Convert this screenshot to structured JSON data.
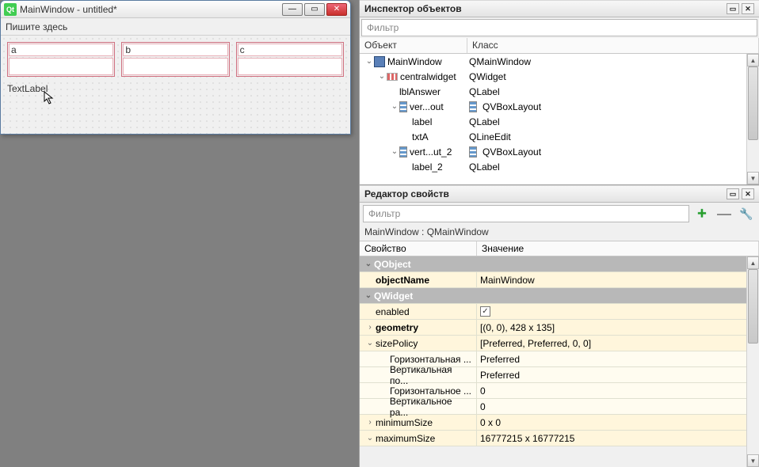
{
  "form": {
    "title": "MainWindow - untitled*",
    "menubar_hint": "Пишите здесь",
    "labels": {
      "a": "a",
      "b": "b",
      "c": "c"
    },
    "textlabel": "TextLabel"
  },
  "inspector": {
    "title": "Инспектор объектов",
    "filter_placeholder": "Фильтр",
    "col_object": "Объект",
    "col_class": "Класс",
    "rows": [
      {
        "indent": 0,
        "arrow": "down",
        "icon": "form",
        "name": "MainWindow",
        "cls_icon": "",
        "cls": "QMainWindow"
      },
      {
        "indent": 1,
        "arrow": "down",
        "icon": "layout",
        "name": "centralwidget",
        "cls_icon": "",
        "cls": "QWidget"
      },
      {
        "indent": 2,
        "arrow": "",
        "icon": "",
        "name": "lblAnswer",
        "cls_icon": "",
        "cls": "QLabel"
      },
      {
        "indent": 2,
        "arrow": "down",
        "icon": "vlayout",
        "name": "ver...out",
        "cls_icon": "vlayout",
        "cls": "QVBoxLayout"
      },
      {
        "indent": 3,
        "arrow": "",
        "icon": "",
        "name": "label",
        "cls_icon": "",
        "cls": "QLabel"
      },
      {
        "indent": 3,
        "arrow": "",
        "icon": "",
        "name": "txtA",
        "cls_icon": "",
        "cls": "QLineEdit"
      },
      {
        "indent": 2,
        "arrow": "down",
        "icon": "vlayout",
        "name": "vert...ut_2",
        "cls_icon": "vlayout",
        "cls": "QVBoxLayout"
      },
      {
        "indent": 3,
        "arrow": "",
        "icon": "",
        "name": "label_2",
        "cls_icon": "",
        "cls": "QLabel"
      }
    ]
  },
  "propeditor": {
    "title": "Редактор свойств",
    "filter_placeholder": "Фильтр",
    "crumb": "MainWindow : QMainWindow",
    "col_prop": "Свойство",
    "col_val": "Значение",
    "rows": [
      {
        "type": "group",
        "arrow": "down",
        "label": "QObject"
      },
      {
        "type": "prop",
        "level": 0,
        "arrow": "",
        "bold": true,
        "key": "objectName",
        "val": "MainWindow"
      },
      {
        "type": "group",
        "arrow": "down",
        "label": "QWidget"
      },
      {
        "type": "prop",
        "level": 0,
        "arrow": "",
        "bold": false,
        "key": "enabled",
        "val": "check"
      },
      {
        "type": "prop",
        "level": 0,
        "arrow": "right",
        "bold": true,
        "key": "geometry",
        "val": "[(0, 0), 428 x 135]"
      },
      {
        "type": "prop",
        "level": 0,
        "arrow": "down",
        "bold": false,
        "key": "sizePolicy",
        "val": "[Preferred, Preferred, 0, 0]"
      },
      {
        "type": "prop",
        "level": 1,
        "arrow": "",
        "bold": false,
        "key": "Горизонтальная ...",
        "val": "Preferred"
      },
      {
        "type": "prop",
        "level": 1,
        "arrow": "",
        "bold": false,
        "key": "Вертикальная по...",
        "val": "Preferred"
      },
      {
        "type": "prop",
        "level": 1,
        "arrow": "",
        "bold": false,
        "key": "Горизонтальное ...",
        "val": "0"
      },
      {
        "type": "prop",
        "level": 1,
        "arrow": "",
        "bold": false,
        "key": "Вертикальное ра...",
        "val": "0"
      },
      {
        "type": "prop",
        "level": 0,
        "arrow": "right",
        "bold": false,
        "key": "minimumSize",
        "val": "0 x 0"
      },
      {
        "type": "prop",
        "level": 0,
        "arrow": "down",
        "bold": false,
        "key": "maximumSize",
        "val": "16777215 x 16777215"
      }
    ]
  }
}
